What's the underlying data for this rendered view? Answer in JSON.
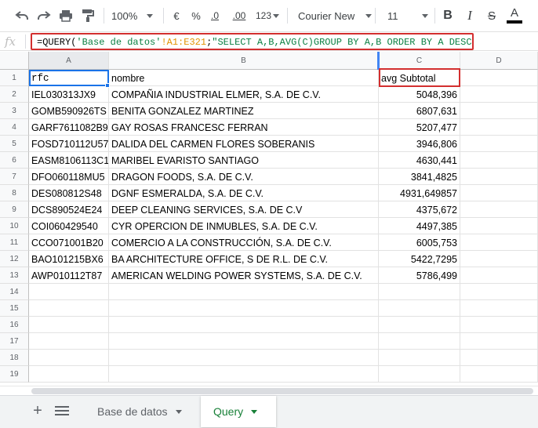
{
  "toolbar": {
    "zoom": "100%",
    "currency": "€",
    "percent": "%",
    "decrease_decimals": ".0",
    "increase_decimals": ".00",
    "more_formats": "123",
    "font": "Courier New",
    "font_size": "11",
    "bold": "B",
    "italic": "I",
    "strikethrough": "S",
    "text_color": "A"
  },
  "formula_bar": {
    "fx": "fx",
    "parts": {
      "p1": "=QUERY(",
      "p2": "'Base de datos'",
      "p3": "!A1:E321",
      "p4": ";",
      "p5": "\"SELECT A,B,AVG(C)GROUP BY A,B ORDER BY A DESC\"",
      "p6": ")"
    }
  },
  "grid": {
    "columns": [
      "A",
      "B",
      "C",
      "D"
    ],
    "rows": [
      {
        "n": "1",
        "a": "rfc",
        "b": "nombre",
        "c": "avg Subtotal"
      },
      {
        "n": "2",
        "a": "IEL030313JX9",
        "b": "COMPAÑIA INDUSTRIAL ELMER, S.A. DE C.V.",
        "c": "5048,396"
      },
      {
        "n": "3",
        "a": "GOMB590926TS",
        "b": "BENITA GONZALEZ MARTINEZ",
        "c": "6807,631"
      },
      {
        "n": "4",
        "a": "GARF7611082B9",
        "b": "GAY ROSAS FRANCESC FERRAN",
        "c": "5207,477"
      },
      {
        "n": "5",
        "a": "FOSD710112U57",
        "b": "DALIDA DEL CARMEN FLORES SOBERANIS",
        "c": "3946,806"
      },
      {
        "n": "6",
        "a": "EASM8106113C1",
        "b": "MARIBEL EVARISTO SANTIAGO",
        "c": "4630,441"
      },
      {
        "n": "7",
        "a": "DFO060118MU5",
        "b": "DRAGON FOODS, S.A. DE C.V.",
        "c": "3841,4825"
      },
      {
        "n": "8",
        "a": "DES080812S48",
        "b": "DGNF ESMERALDA, S.A. DE C.V.",
        "c": "4931,649857"
      },
      {
        "n": "9",
        "a": "DCS890524E24",
        "b": "DEEP CLEANING SERVICES, S.A. DE C.V",
        "c": "4375,672"
      },
      {
        "n": "10",
        "a": "COI060429540",
        "b": "CYR OPERCION DE INMUBLES, S.A. DE C.V.",
        "c": "4497,385"
      },
      {
        "n": "11",
        "a": "CCO071001B20",
        "b": "COMERCIO A LA CONSTRUCCIÓN, S.A. DE C.V.",
        "c": "6005,753"
      },
      {
        "n": "12",
        "a": "BAO101215BX6",
        "b": "BA ARCHITECTURE OFFICE, S DE R.L. DE C.V.",
        "c": "5422,7295"
      },
      {
        "n": "13",
        "a": "AWP010112T87",
        "b": "AMERICAN WELDING POWER SYSTEMS, S.A. DE C.V.",
        "c": "5786,499"
      },
      {
        "n": "14",
        "a": "",
        "b": "",
        "c": ""
      },
      {
        "n": "15",
        "a": "",
        "b": "",
        "c": ""
      },
      {
        "n": "16",
        "a": "",
        "b": "",
        "c": ""
      },
      {
        "n": "17",
        "a": "",
        "b": "",
        "c": ""
      },
      {
        "n": "18",
        "a": "",
        "b": "",
        "c": ""
      },
      {
        "n": "19",
        "a": "",
        "b": "",
        "c": ""
      }
    ]
  },
  "sheets": {
    "tabs": [
      "Base de datos",
      "Query"
    ],
    "active": "Query"
  },
  "colors": {
    "highlight_border": "#d32f2f",
    "selection": "#1a73e8",
    "active_tab": "#188038",
    "formula_string": "#0b8043",
    "formula_range": "#e29200"
  }
}
